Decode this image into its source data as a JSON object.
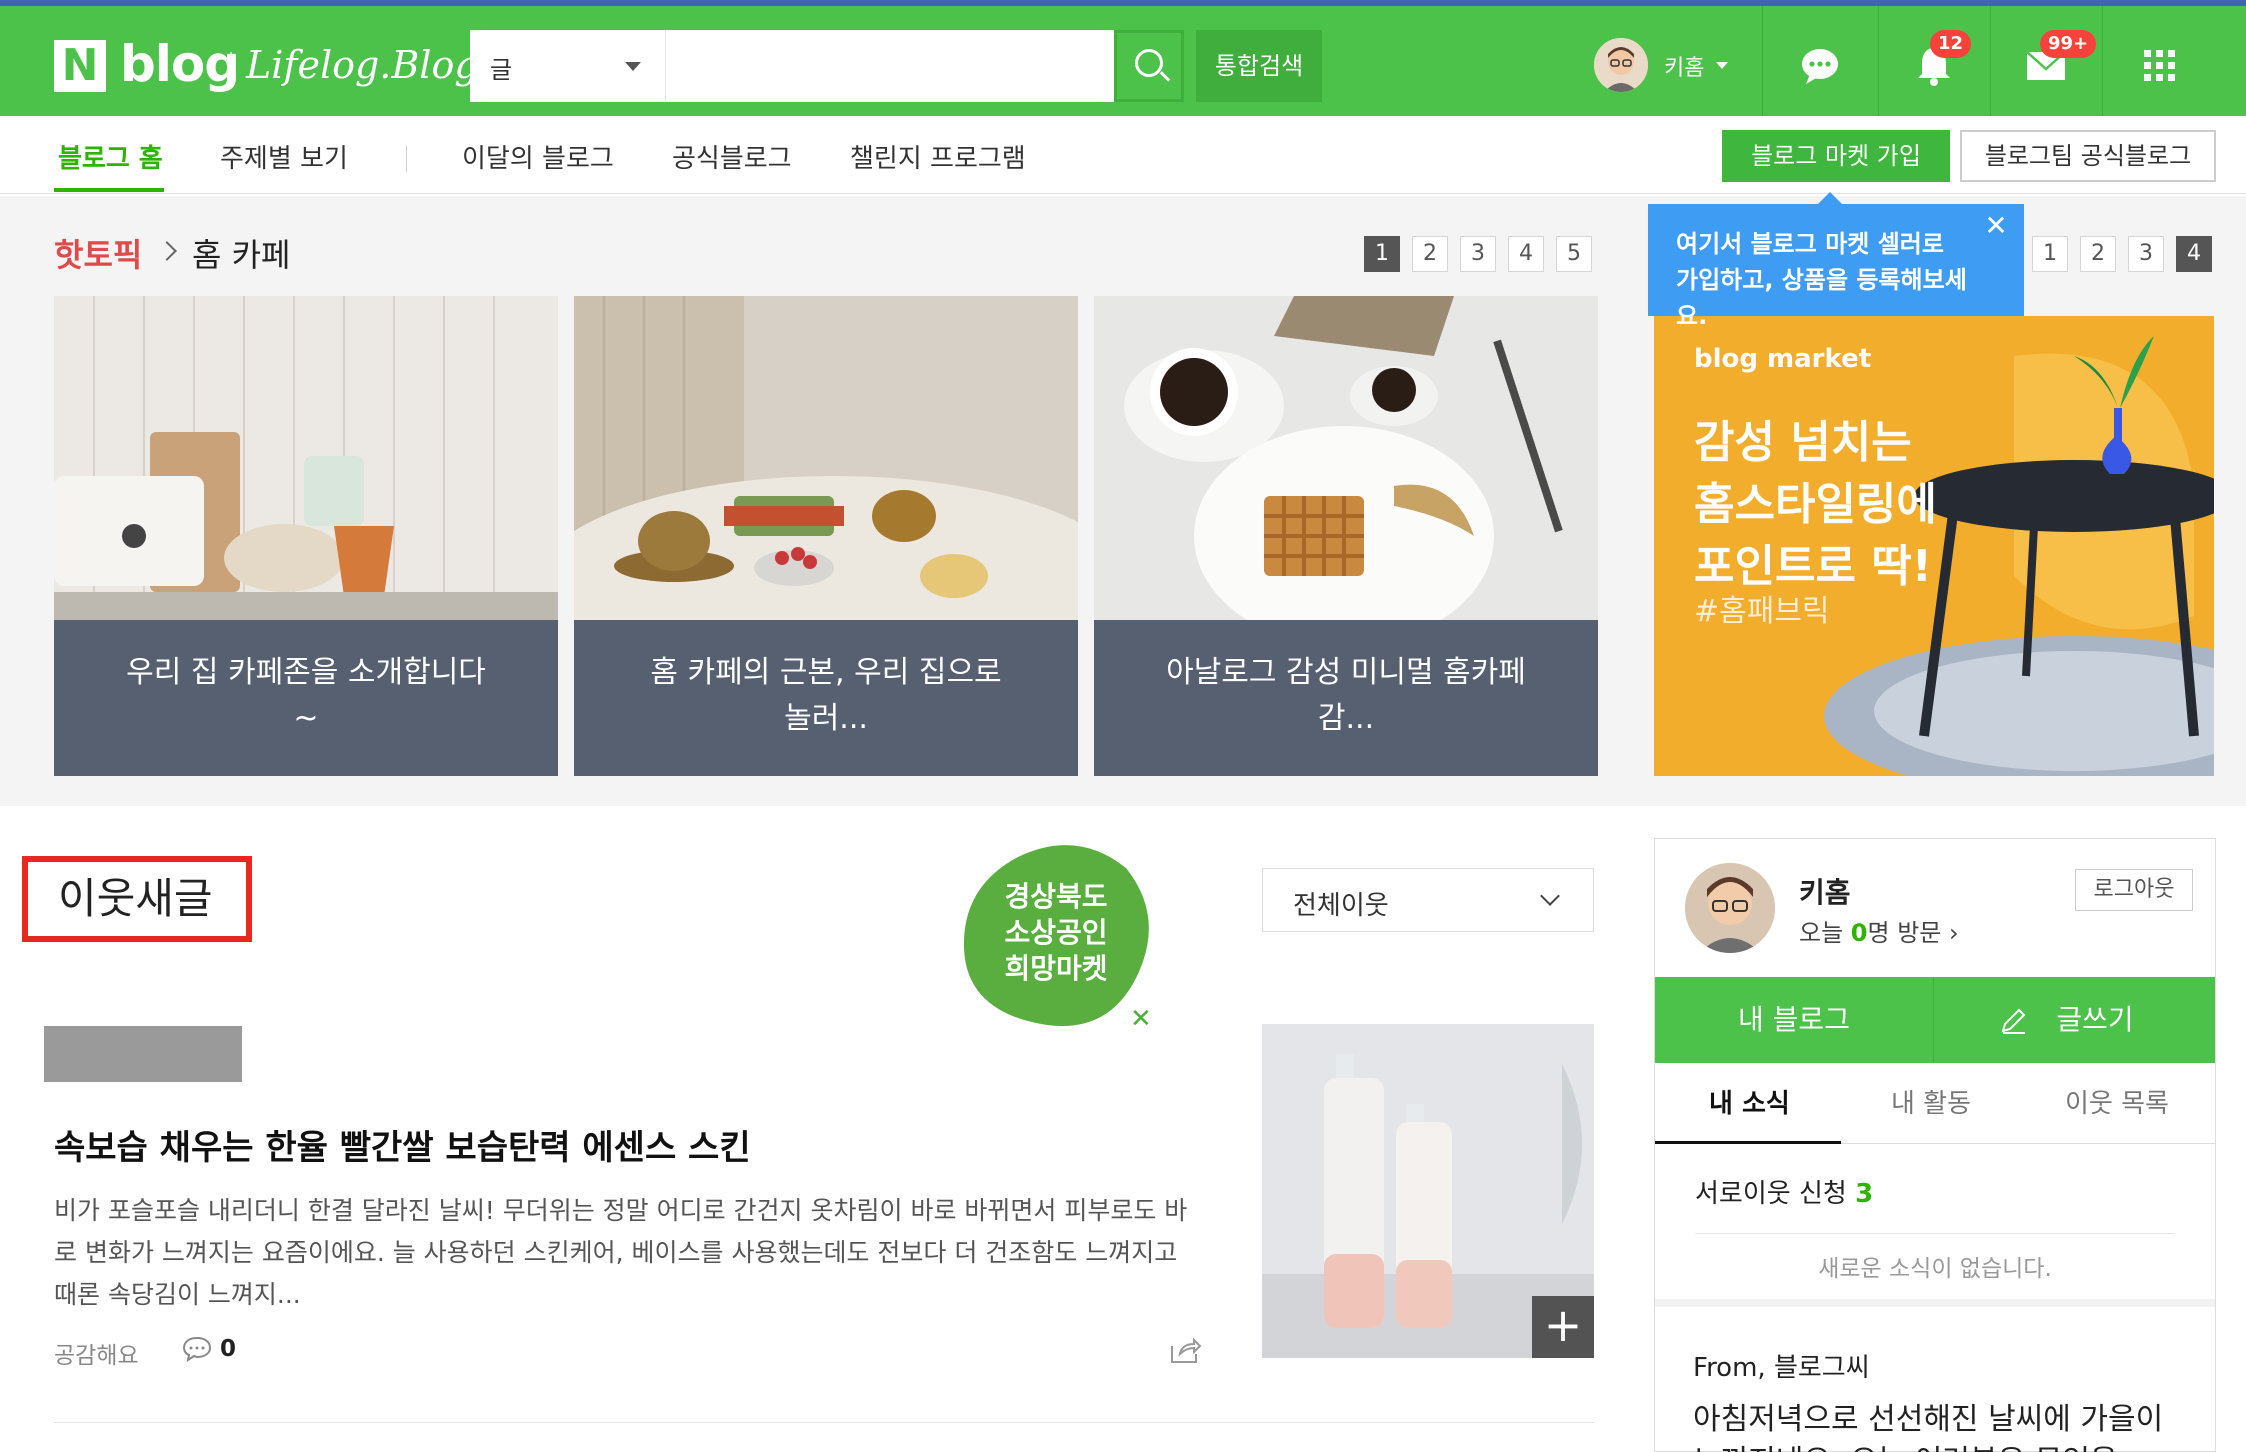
{
  "header": {
    "logo_n": "N",
    "logo_blog": "blog",
    "logo_lifelog": "Lifelog.Blog",
    "search_scope": "글",
    "search_placeholder": "",
    "unified_search": "통합검색",
    "username": "키홈",
    "notification_count": "12",
    "mail_count": "99+"
  },
  "nav": {
    "items": [
      "블로그 홈",
      "주제별 보기",
      "이달의 블로그",
      "공식블로그",
      "챌린지 프로그램"
    ],
    "market_join": "블로그 마켓 가입",
    "official_team": "블로그팀 공식블로그"
  },
  "hot_topic": {
    "title": "핫토픽",
    "subtitle": "홈 카페",
    "pages": [
      "1",
      "2",
      "3",
      "4",
      "5"
    ],
    "cards": [
      {
        "caption": "우리 집 카페존을 소개합니다~"
      },
      {
        "caption": "홈 카페의 근본, 우리 집으로 놀러..."
      },
      {
        "caption": "아날로그 감성 미니멀 홈카페 감..."
      }
    ]
  },
  "tooltip": {
    "text_line1": "여기서 블로그 마켓 셀러로",
    "text_line2": "가입하고, 상품을 등록해보세요.",
    "close": "✕"
  },
  "promo": {
    "pages": [
      "1",
      "2",
      "3",
      "4"
    ],
    "brand": "blog market",
    "line1": "감성 넘치는",
    "line2": "홈스타일링에",
    "line3": "포인트로 딱!",
    "tag": "#홈패브릭"
  },
  "neighbor": {
    "title": "이웃새글",
    "campaign_line1": "경상북도",
    "campaign_line2": "소상공인",
    "campaign_line3": "희망마켓",
    "filter": "전체이웃",
    "post": {
      "title": "속보습 채우는 한율 빨간쌀 보습탄력 에센스 스킨",
      "body": "비가 포슬포슬 내리더니 한결 달라진 날씨! 무더위는 정말 어디로 간건지 옷차림이 바로 바뀌면서 피부로도 바로 변화가 느껴지는 요즘이에요. 늘 사용하던 스킨케어, 베이스를 사용했는데도 전보다 더 건조함도 느껴지고 때론 속당김이 느껴지...",
      "like_label": "공감해요",
      "comment_count": "0"
    }
  },
  "profile": {
    "name": "키홈",
    "visit_prefix": "오늘 ",
    "visit_count": "0",
    "visit_suffix": "명 방문 ›",
    "logout": "로그아웃",
    "my_blog": "내 블로그",
    "write": "글쓰기",
    "tabs": [
      "내 소식",
      "내 활동",
      "이웃 목록"
    ],
    "request_label": "서로이웃 신청 ",
    "request_count": "3",
    "no_news": "새로운 소식이 없습니다.",
    "from_label": "From, 블로그씨",
    "from_text": "아침저녁으로 선선해진 날씨에 가을이 느껴지네요. 오늘 여러분은 무엇을"
  },
  "colors": {
    "brand_green": "#4cc24a",
    "hot_red": "#e04a4a",
    "highlight_red": "#e8281f",
    "tooltip_blue": "#3f9cf3",
    "promo_orange": "#f3ad2c"
  }
}
